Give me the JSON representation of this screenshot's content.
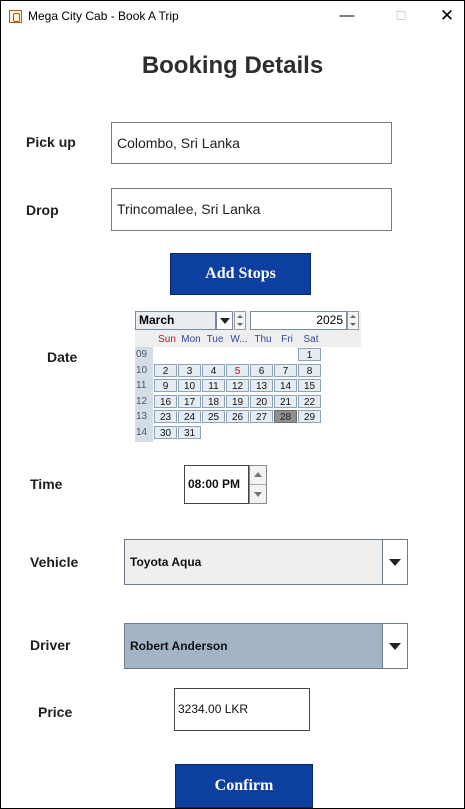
{
  "window": {
    "title": "Mega City Cab - Book A Trip",
    "min_symbol": "—",
    "max_symbol": "☐",
    "close_symbol": "✕"
  },
  "heading": "Booking Details",
  "pickup": {
    "label": "Pick up",
    "value": "Colombo, Sri Lanka"
  },
  "drop": {
    "label": "Drop",
    "value": "Trincomalee, Sri Lanka"
  },
  "add_stops_label": "Add Stops",
  "date": {
    "label": "Date",
    "month": "March",
    "year": "2025",
    "weekdays": [
      "Sun",
      "Mon",
      "Tue",
      "W...",
      "Thu",
      "Fri",
      "Sat"
    ],
    "weeks": [
      {
        "num": "09",
        "days": [
          "",
          "",
          "",
          "",
          "",
          "",
          "1"
        ]
      },
      {
        "num": "10",
        "days": [
          "2",
          "3",
          "4",
          "5",
          "6",
          "7",
          "8"
        ]
      },
      {
        "num": "11",
        "days": [
          "9",
          "10",
          "11",
          "12",
          "13",
          "14",
          "15"
        ]
      },
      {
        "num": "12",
        "days": [
          "16",
          "17",
          "18",
          "19",
          "20",
          "21",
          "22"
        ]
      },
      {
        "num": "13",
        "days": [
          "23",
          "24",
          "25",
          "26",
          "27",
          "28",
          "29"
        ]
      },
      {
        "num": "14",
        "days": [
          "30",
          "31",
          "",
          "",
          "",
          "",
          ""
        ]
      }
    ],
    "selected_day": "28",
    "highlighted_day": "5"
  },
  "time": {
    "label": "Time",
    "value": "08:00 PM"
  },
  "vehicle": {
    "label": "Vehicle",
    "value": "Toyota Aqua"
  },
  "driver": {
    "label": "Driver",
    "value": "Robert Anderson"
  },
  "price": {
    "label": "Price",
    "value": "3234.00 LKR"
  },
  "confirm_label": "Confirm",
  "colors": {
    "button": "#0d3fa1",
    "driver_combo": "#a3b4c7",
    "calendar_day": "#e6ecf3",
    "selected_day": "#8f8f8f",
    "sunday_red": "#b0182a"
  }
}
